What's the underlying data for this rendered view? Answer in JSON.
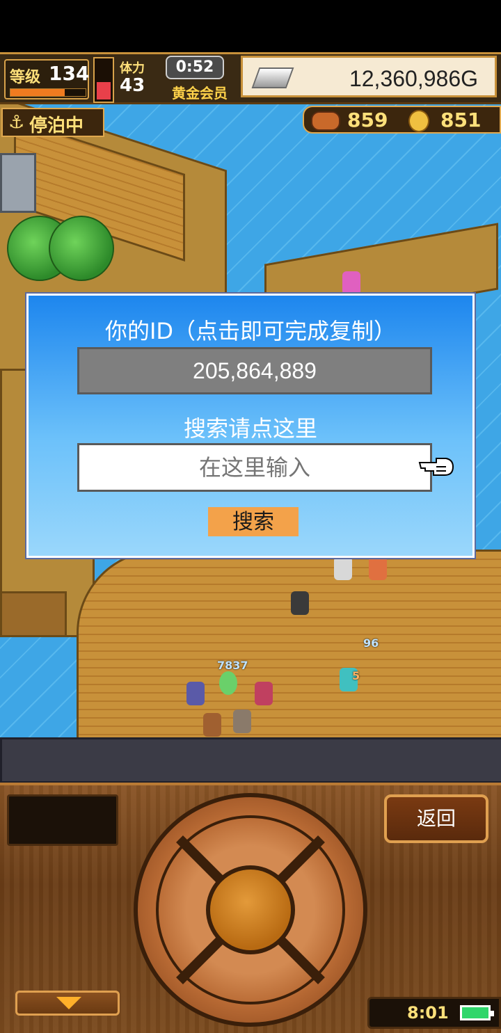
{
  "hud": {
    "level_label": "等级",
    "level_value": "134",
    "level_progress": 0.72,
    "hp_fill_fraction": 0.5,
    "stamina_label": "体力",
    "stamina_value": "43",
    "timer": "0:52",
    "membership": "黄金会员",
    "gold": "12,360,986G",
    "status": "停泊中",
    "status_icon": "anchor-icon",
    "resource_bean": "859",
    "resource_coin": "851"
  },
  "dialog": {
    "id_title": "你的ID（点击即可完成复制）",
    "id_value": "205,864,889",
    "search_title": "搜索请点这里",
    "search_placeholder": "在这里输入",
    "search_button": "搜索"
  },
  "world": {
    "damage_numbers": [
      "96",
      "7837",
      "5"
    ]
  },
  "controls": {
    "back_button": "返回",
    "clock": "8:01"
  },
  "colors": {
    "dialog_top": "#1d86ee",
    "dialog_bottom": "#9ad7fb",
    "search_button": "#f3a24a",
    "battery": "#2fd66a"
  }
}
